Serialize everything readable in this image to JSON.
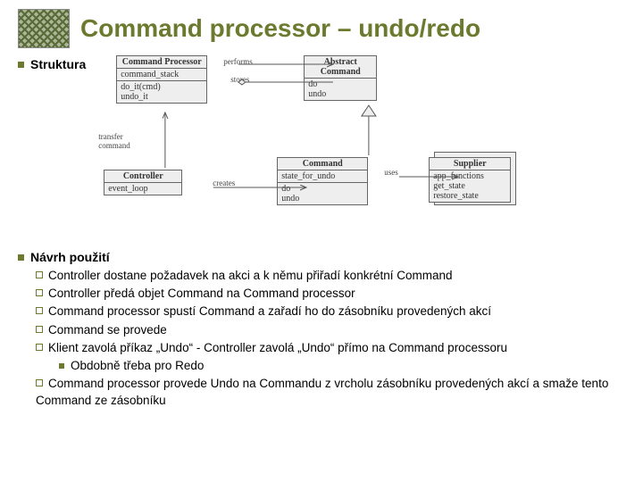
{
  "title": "Command processor – undo/redo",
  "section1": "Struktura",
  "section2": "Návrh použití",
  "diagram": {
    "cmdproc": {
      "name": "Command Processor",
      "attr": "command_stack",
      "ops": "do_it(cmd)\nundo_it"
    },
    "abscmd": {
      "name": "Abstract Command",
      "ops": "do\nundo"
    },
    "controller": {
      "name": "Controller",
      "attr": "event_loop"
    },
    "command": {
      "name": "Command",
      "attr": "state_for_undo",
      "ops": "do\nundo"
    },
    "supplier": {
      "name": "Supplier",
      "ops": "app_functions\nget_state\nrestore_state"
    },
    "lbl_performs": "performs",
    "lbl_stores": "stores",
    "lbl_transfer": "transfer command",
    "lbl_creates": "creates",
    "lbl_uses": "uses"
  },
  "bullets": {
    "b1": "Controller dostane požadavek na akci a k němu přiřadí konkrétní Command",
    "b2": "Controller předá objet Command na Command processor",
    "b3": "Command processor spustí Command a zařadí ho do zásobníku provedených akcí",
    "b4": "Command se provede",
    "b5": "Klient zavolá příkaz „Undo“ - Controller zavolá „Undo“ přímo na Command processoru",
    "b5a": "Obdobně třeba pro Redo",
    "b6": "Command processor provede Undo na Commandu z vrcholu zásobníku provedených akcí a smaže tento Command ze zásobníku"
  }
}
